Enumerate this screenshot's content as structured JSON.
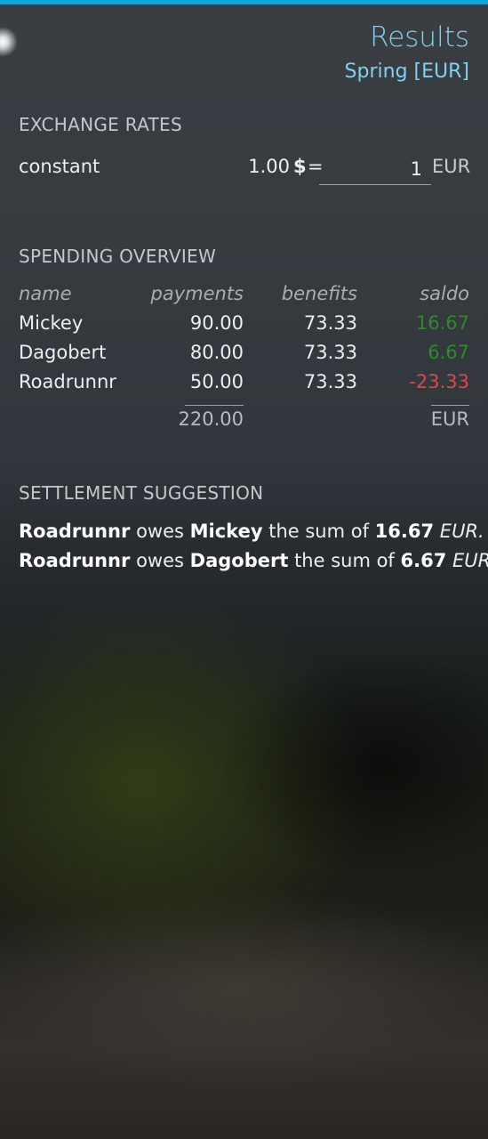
{
  "header": {
    "title": "Results",
    "subtitle": "Spring [EUR]"
  },
  "exchange_rates": {
    "heading": "EXCHANGE RATES",
    "label": "constant",
    "amount": "1.00",
    "currency_symbol": "$",
    "equals": "=",
    "value": "1",
    "target_currency": "EUR"
  },
  "spending_overview": {
    "heading": "SPENDING OVERVIEW",
    "columns": [
      "name",
      "payments",
      "benefits",
      "saldo"
    ],
    "rows": [
      {
        "name": "Mickey",
        "payments": "90.00",
        "benefits": "73.33",
        "saldo": "16.67",
        "saldo_color": "#2f8a2a"
      },
      {
        "name": "Dagobert",
        "payments": "80.00",
        "benefits": "73.33",
        "saldo": "6.67",
        "saldo_color": "#2f8a2a"
      },
      {
        "name": "Roadrunnr",
        "payments": "50.00",
        "benefits": "73.33",
        "saldo": "-23.33",
        "saldo_color": "#e0464a"
      }
    ],
    "total_payments": "220.00",
    "total_currency": "EUR"
  },
  "settlement": {
    "heading": "SETTLEMENT SUGGESTION",
    "lines": [
      {
        "debtor": "Roadrunnr",
        "owes": "owes",
        "creditor": "Mickey",
        "sum_text": "the sum of",
        "amount": "16.67",
        "currency": "EUR."
      },
      {
        "debtor": "Roadrunnr",
        "owes": "owes",
        "creditor": "Dagobert",
        "sum_text": "the sum of",
        "amount": "6.67",
        "currency": "EUR."
      }
    ]
  },
  "colors": {
    "accent": "#14a4d9",
    "header_text": "#7fd1ee",
    "positive": "#2f8a2a",
    "negative": "#e0464a"
  }
}
